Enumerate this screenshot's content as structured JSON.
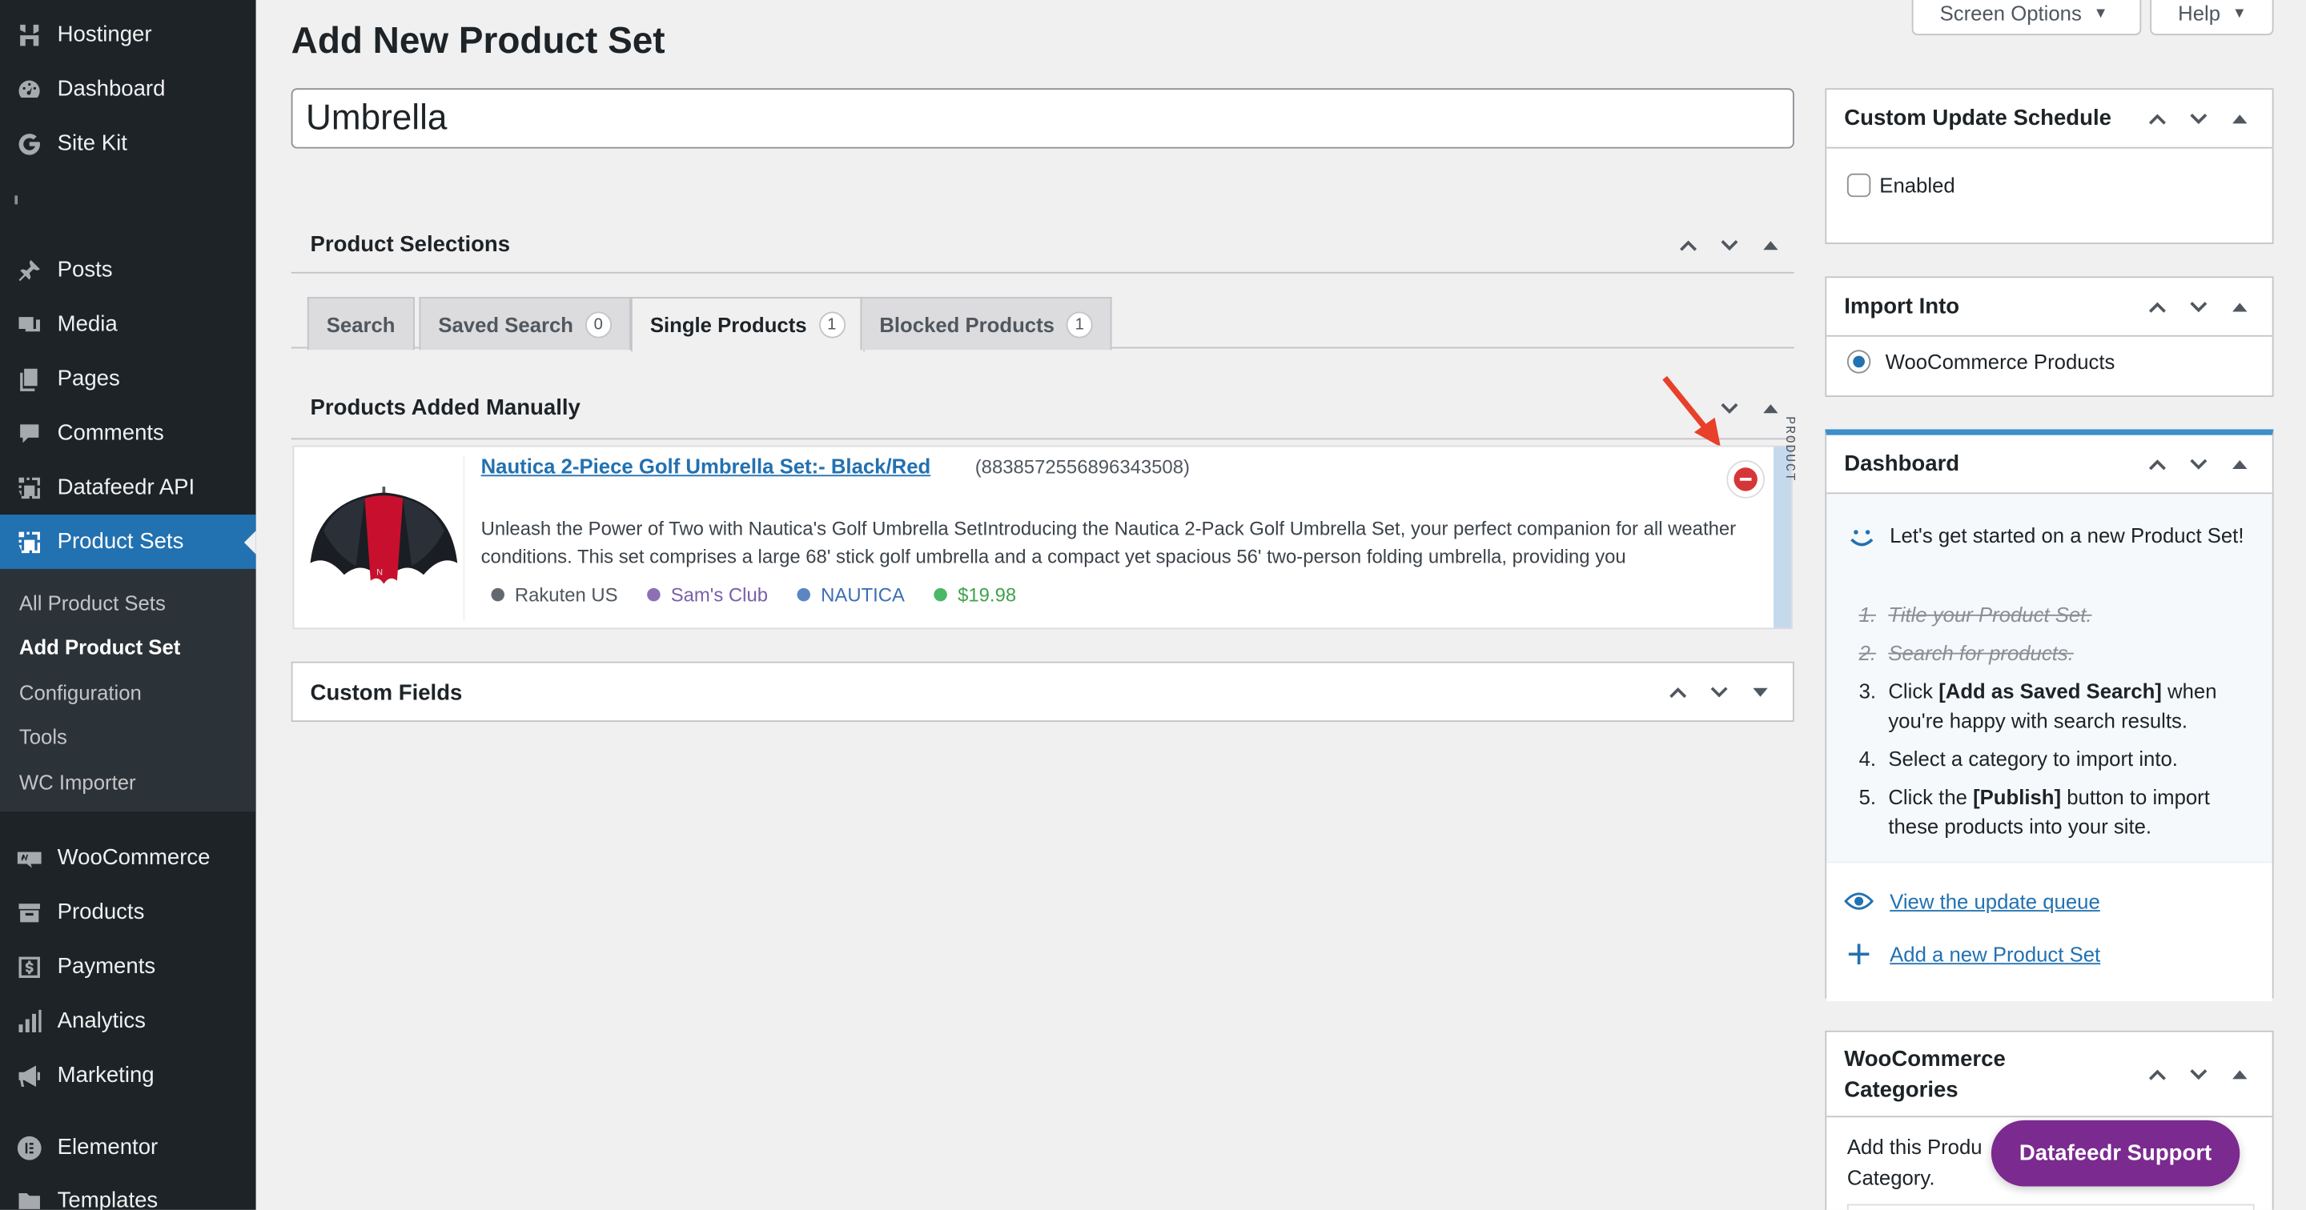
{
  "sidebar": {
    "top_items": [
      {
        "label": "Hostinger",
        "icon": "hostinger-icon"
      },
      {
        "label": "Dashboard",
        "icon": "dashboard-icon"
      },
      {
        "label": "Site Kit",
        "icon": "google-icon"
      }
    ],
    "items": [
      {
        "label": "Posts",
        "icon": "pin-icon"
      },
      {
        "label": "Media",
        "icon": "media-icon"
      },
      {
        "label": "Pages",
        "icon": "pages-icon"
      },
      {
        "label": "Comments",
        "icon": "comment-icon"
      },
      {
        "label": "Datafeedr API",
        "icon": "datafeedr-icon"
      },
      {
        "label": "Product Sets",
        "icon": "datafeedr-icon",
        "active": true
      }
    ],
    "submenu": [
      {
        "label": "All Product Sets"
      },
      {
        "label": "Add Product Set",
        "current": true
      },
      {
        "label": "Configuration"
      },
      {
        "label": "Tools"
      },
      {
        "label": "WC Importer"
      }
    ],
    "bottom_items": [
      {
        "label": "WooCommerce",
        "icon": "woocommerce-icon"
      },
      {
        "label": "Products",
        "icon": "archive-icon"
      },
      {
        "label": "Payments",
        "icon": "dollar-icon"
      },
      {
        "label": "Analytics",
        "icon": "bar-chart-icon"
      },
      {
        "label": "Marketing",
        "icon": "megaphone-icon"
      },
      {
        "label": "Elementor",
        "icon": "elementor-icon"
      },
      {
        "label": "Templates",
        "icon": "folder-icon"
      }
    ]
  },
  "header": {
    "screen_options": "Screen Options",
    "help": "Help",
    "page_title": "Add New Product Set",
    "title_value": "Umbrella"
  },
  "product_selections": {
    "title": "Product Selections",
    "tabs": [
      {
        "label": "Search",
        "count": null
      },
      {
        "label": "Saved Search",
        "count": "0"
      },
      {
        "label": "Single Products",
        "count": "1",
        "active": true
      },
      {
        "label": "Blocked Products",
        "count": "1"
      }
    ]
  },
  "manual": {
    "title": "Products Added Manually",
    "product": {
      "name": "Nautica 2-Piece Golf Umbrella Set:- Black/Red",
      "id": "(8838572556896343508)",
      "description": "Unleash the Power of Two with Nautica's Golf Umbrella SetIntroducing the Nautica 2-Pack Golf Umbrella Set, your perfect companion for all weather conditions. This set comprises a large 68' stick golf umbrella and a compact yet spacious 56' two-person folding umbrella, providing you",
      "network": "Rakuten US",
      "merchant": "Sam's Club",
      "brand": "NAUTICA",
      "price": "$19.98",
      "type_label": "PRODUCT"
    }
  },
  "custom_fields": {
    "title": "Custom Fields"
  },
  "right": {
    "schedule": {
      "title": "Custom Update Schedule",
      "enabled_label": "Enabled"
    },
    "import_into": {
      "title": "Import Into",
      "option": "WooCommerce Products"
    },
    "dashboard": {
      "title": "Dashboard",
      "intro": "Let's get started on a new Product Set!",
      "steps": [
        {
          "n": "1.",
          "text": "Title your Product Set.",
          "done": true
        },
        {
          "n": "2.",
          "text": "Search for products.",
          "done": true
        },
        {
          "n": "3.",
          "pre": "Click ",
          "bold": "[Add as Saved Search]",
          "post": " when you're happy with search results."
        },
        {
          "n": "4.",
          "text": "Select a category to import into."
        },
        {
          "n": "5.",
          "pre": "Click the ",
          "bold": "[Publish]",
          "post": " button to import these products into your site."
        }
      ],
      "link_queue": "View the update queue",
      "link_new": "Add a new Product Set"
    },
    "categories": {
      "title_line1": "WooCommerce",
      "title_line2": "Categories",
      "text_line1": "Add this Produ",
      "text_line2": "Category."
    }
  },
  "support_button": "Datafeedr Support",
  "colors": {
    "sidebar_bg": "#1d2327",
    "accent": "#2271b1",
    "support": "#7b2a8f",
    "remove": "#d63638",
    "price": "#4ab866"
  }
}
